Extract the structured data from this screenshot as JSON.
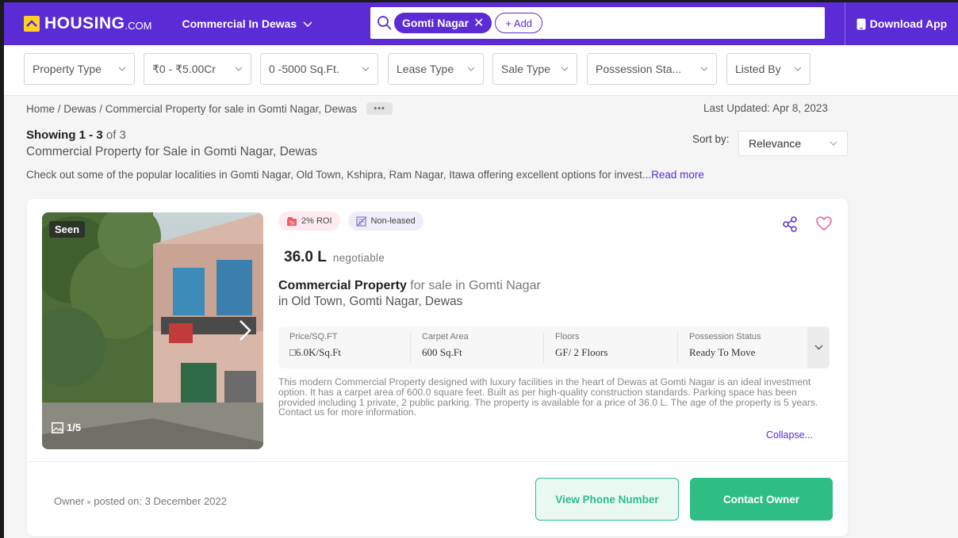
{
  "header": {
    "logo_text": "HOUSING",
    "logo_tld": ".COM",
    "city_selector": "Commercial In Dewas",
    "search_chip": "Gomti Nagar",
    "add_button": "+ Add",
    "download_app": "Download App",
    "brand_color": "#5b2bd6",
    "logo_accent": "#ffd024"
  },
  "filters": [
    {
      "label": "Property Type"
    },
    {
      "label": "₹0 - ₹5.00Cr"
    },
    {
      "label": "0 -5000 Sq.Ft."
    },
    {
      "label": "Lease Type"
    },
    {
      "label": "Sale Type"
    },
    {
      "label": "Possession Sta..."
    },
    {
      "label": "Listed By"
    }
  ],
  "breadcrumb": {
    "text": "Home / Dewas / Commercial Property for sale in Gomti Nagar, Dewas",
    "more": "•••"
  },
  "last_updated": "Last Updated: Apr 8, 2023",
  "results": {
    "showing": "Showing 1 - 3",
    "of": "of 3",
    "subtitle": "Commercial Property for Sale in Gomti Nagar, Dewas",
    "description": "Check out some of the popular localities in Gomti Nagar, Old Town, Kshipra, Ram Nagar, Itawa offering excellent options for invest...",
    "read_more": "Read more"
  },
  "sort": {
    "label": "Sort by:",
    "value": "Relevance"
  },
  "listing": {
    "seen_badge": "Seen",
    "photo_count": "1/5",
    "tag_roi": "2% ROI",
    "tag_lease": "Non-leased",
    "price": "36.0 L",
    "price_note": "negotiable",
    "title_bold": "Commercial Property",
    "title_rest": " for sale in Gomti Nagar",
    "location": "in Old Town, Gomti Nagar, Dewas",
    "specs": [
      {
        "label": "Price/SQ.FT",
        "value": "□6.0K/Sq.Ft"
      },
      {
        "label": "Carpet Area",
        "value": "600 Sq.Ft"
      },
      {
        "label": "Floors",
        "value": "GF/ 2 Floors"
      },
      {
        "label": "Possession Status",
        "value": "Ready To Move"
      }
    ],
    "description": "This modern Commercial Property designed with luxury facilities in the heart of Dewas at Gomti Nagar is an ideal investment option. It has a carpet area of 600.0 square feet. Built as per high-quality construction standards. Parking space has been provided including 1 private, 2 public parking. The property is available for a price of 36.0 L. The age of the property is 5 years. Contact us for more information.",
    "collapse": "Collapse...",
    "posted_by": "Owner",
    "posted_on": "posted on: 3 December 2022",
    "view_phone": "View Phone Number",
    "contact": "Contact Owner",
    "accent_green": "#2ebd85"
  },
  "icons": [
    "search-icon",
    "close-icon",
    "chevron-down-icon",
    "phone-icon",
    "share-icon",
    "heart-icon",
    "gallery-icon",
    "chevron-right-icon",
    "roi-icon",
    "lease-icon"
  ]
}
